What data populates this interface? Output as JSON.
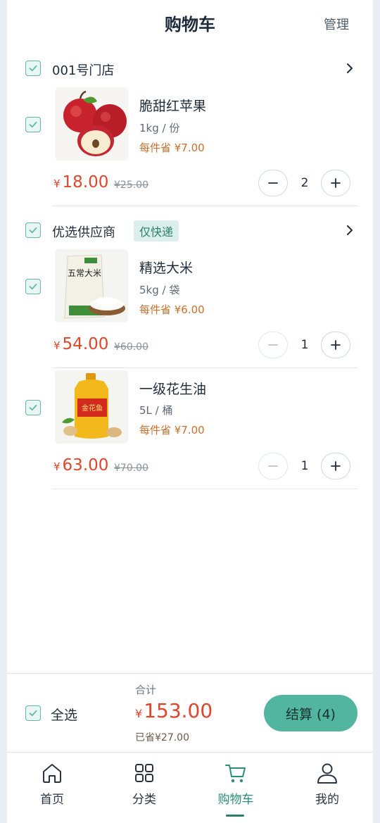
{
  "header": {
    "title": "购物车",
    "manage": "管理"
  },
  "groups": [
    {
      "name": "001号门店",
      "tag": "",
      "items": [
        {
          "name": "脆甜红苹果",
          "spec": "1kg / 份",
          "save": "每件省 ¥7.00",
          "currency": "¥",
          "price": "18.00",
          "original": "¥25.00",
          "qty": "2",
          "image": "apple"
        }
      ]
    },
    {
      "name": "优选供应商",
      "tag": "仅快递",
      "items": [
        {
          "name": "精选大米",
          "spec": "5kg / 袋",
          "save": "每件省 ¥6.00",
          "currency": "¥",
          "price": "54.00",
          "original": "¥60.00",
          "qty": "1",
          "image": "rice-bag",
          "image_text": "五常大米"
        },
        {
          "name": "一级花生油",
          "spec": "5L / 桶",
          "save": "每件省 ¥7.00",
          "currency": "¥",
          "price": "63.00",
          "original": "¥70.00",
          "qty": "1",
          "image": "oil-bottle",
          "image_text": "金花鱼"
        }
      ]
    }
  ],
  "summary": {
    "select_all": "全选",
    "total_label": "合计",
    "currency": "¥",
    "total": "153.00",
    "saved": "已省¥27.00",
    "checkout": "结算 (4)"
  },
  "tabbar": [
    {
      "label": "首页",
      "icon": "home-icon"
    },
    {
      "label": "分类",
      "icon": "grid-icon"
    },
    {
      "label": "购物车",
      "icon": "cart-icon",
      "active": true
    },
    {
      "label": "我的",
      "icon": "user-icon"
    }
  ],
  "colors": {
    "accent": "#52b59f",
    "price": "#e2452b",
    "save": "#c9702c"
  }
}
